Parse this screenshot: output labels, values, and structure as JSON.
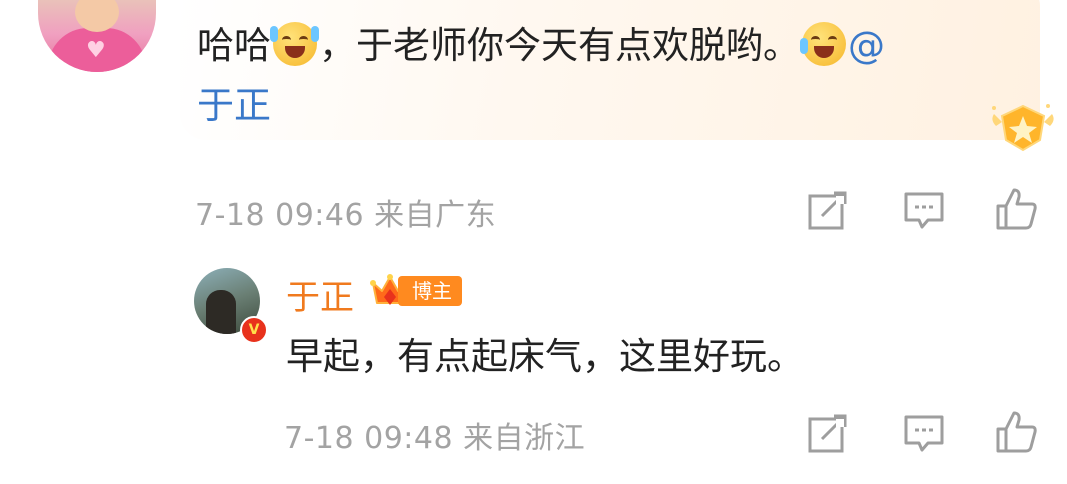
{
  "comment": {
    "text_part1": "哈哈",
    "text_part2": "，于老师你今天有点欢脱哟。",
    "mention_prefix": "@",
    "mention_name": "于正",
    "date": "7-18 09:46",
    "location": "来自广东",
    "emoji_icons": [
      "scream-laugh-emoji-icon",
      "tears-of-joy-emoji-icon"
    ],
    "actions": [
      "share-icon",
      "reply-comment-icon",
      "like-icon"
    ]
  },
  "reply": {
    "username": "于正",
    "tag": "博主",
    "verified_badge": "V",
    "text": "早起，有点起床气，这里好玩。",
    "date": "7-18 09:48",
    "location": "来自浙江",
    "actions": [
      "share-icon",
      "reply-comment-icon",
      "like-icon"
    ]
  },
  "watermark": "",
  "colors": {
    "mention": "#3a78c9",
    "username": "#f07a1e",
    "meta_gray": "#a3a3a3",
    "blogger_tag": "#ff8a1f"
  }
}
